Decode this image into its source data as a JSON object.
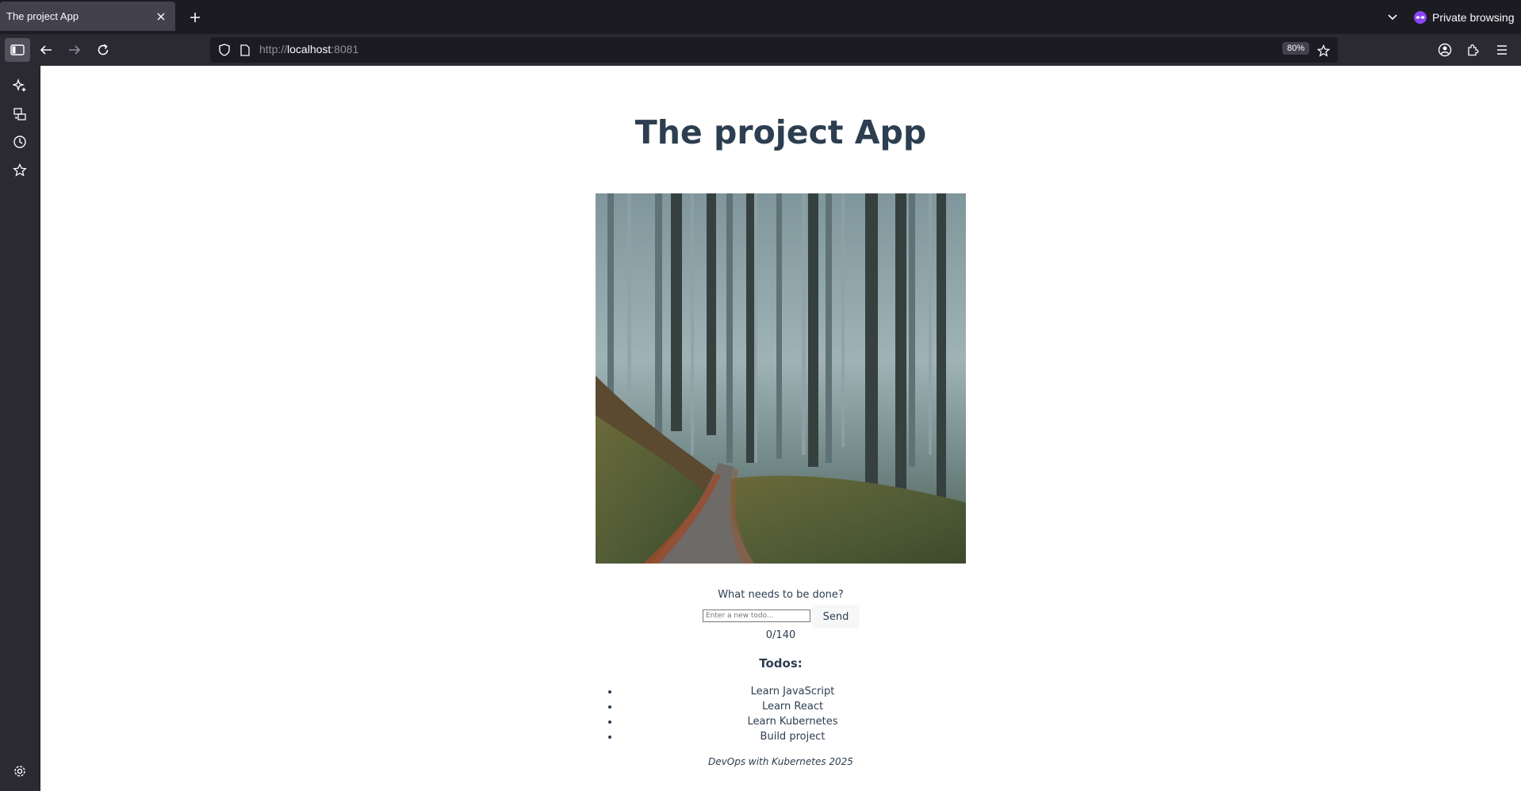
{
  "browser": {
    "tab_title": "The project App",
    "private_label": "Private browsing",
    "url_scheme": "http://",
    "url_host": "localhost",
    "url_port": ":8081",
    "zoom": "80%"
  },
  "sidebar": {
    "icons": [
      "ai-chat-icon",
      "synced-tabs-icon",
      "history-icon",
      "bookmarks-icon",
      "settings-icon"
    ]
  },
  "page": {
    "title": "The project App",
    "image_alt": "Misty forest with a dirt path winding through tall trees",
    "prompt": "What needs to be done?",
    "input_placeholder": "Enter a new todo...",
    "input_value": "",
    "send_label": "Send",
    "counter": "0/140",
    "todos_heading": "Todos:",
    "todos": [
      {
        "text": "Learn JavaScript"
      },
      {
        "text": "Learn React"
      },
      {
        "text": "Learn Kubernetes"
      },
      {
        "text": "Build project"
      }
    ],
    "footer": "DevOps with Kubernetes 2025"
  }
}
